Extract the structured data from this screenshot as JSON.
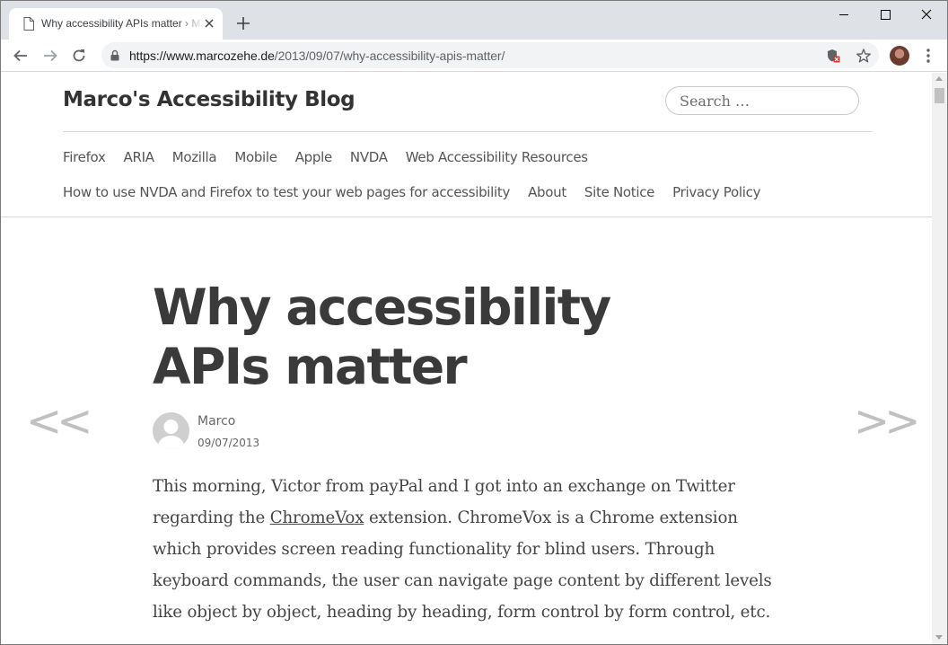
{
  "browser": {
    "tab_title": "Why accessibility APIs matter › Marco's Accessibility Blog",
    "url_host": "https://www.marcozehe.de",
    "url_path": "/2013/09/07/why-accessibility-apis-matter/",
    "icons": [
      "page-icon",
      "close-icon",
      "plus-icon",
      "minimize-icon",
      "maximize-icon",
      "close-window-icon",
      "back-arrow-icon",
      "forward-arrow-icon",
      "reload-icon",
      "lock-icon",
      "tracker-blocked-icon",
      "star-icon",
      "profile-avatar",
      "kebab-menu-icon"
    ]
  },
  "site": {
    "title": "Marco's Accessibility Blog",
    "search_placeholder": "Search …"
  },
  "menu": {
    "row1": [
      "Firefox",
      "ARIA",
      "Mozilla",
      "Mobile",
      "Apple",
      "NVDA",
      "Web Accessibility Resources"
    ],
    "row2": [
      "How to use NVDA and Firefox to test your web pages for accessibility",
      "About",
      "Site Notice",
      "Privacy Policy"
    ]
  },
  "post": {
    "title": "Why accessibility APIs matter",
    "author": "Marco",
    "date": "09/07/2013",
    "body_before": "This morning, Victor from payPal and I got into an exchange on Twitter regarding the ",
    "body_link": "ChromeVox",
    "body_after": " extension. ChromeVox is a Chrome extension which provides screen reading functionality for blind users. Through keyboard commands, the user can navigate page content by different levels like object by object, heading by heading, form control by form control, etc."
  },
  "post_nav": {
    "previous": "<<",
    "next": ">>"
  }
}
